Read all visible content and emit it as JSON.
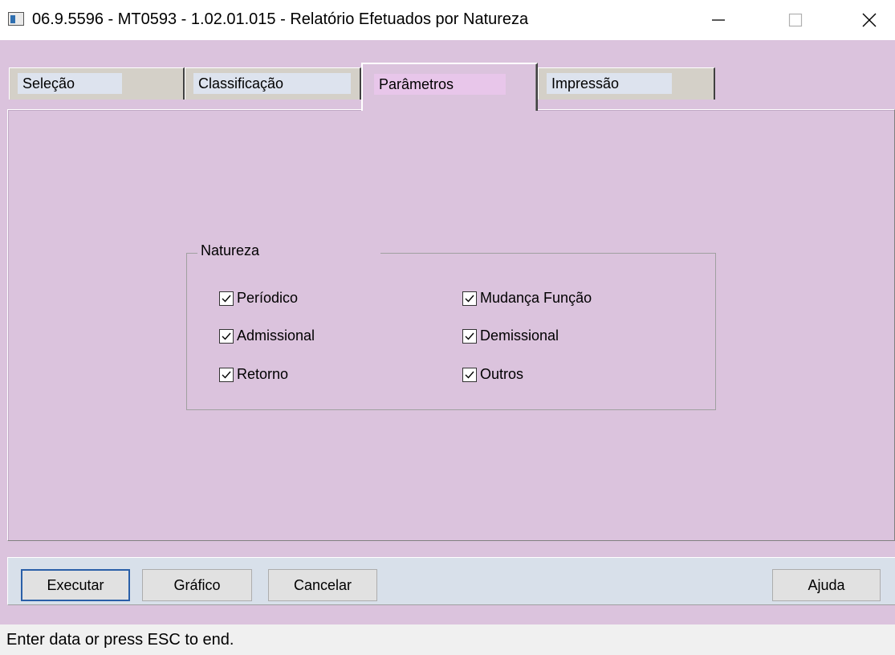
{
  "window": {
    "title": "06.9.5596 - MT0593 - 1.02.01.015 - Relatório Efetuados por Natureza"
  },
  "tabs": [
    {
      "label": "Seleção",
      "active": false
    },
    {
      "label": "Classificação",
      "active": false
    },
    {
      "label": "Parâmetros",
      "active": true
    },
    {
      "label": "Impressão",
      "active": false
    }
  ],
  "natureza": {
    "title": "Natureza",
    "options": [
      {
        "label": "Períodico",
        "checked": true
      },
      {
        "label": "Admissional",
        "checked": true
      },
      {
        "label": "Retorno",
        "checked": true
      },
      {
        "label": "Mudança Função",
        "checked": true
      },
      {
        "label": "Demissional",
        "checked": true
      },
      {
        "label": "Outros",
        "checked": true
      }
    ]
  },
  "buttons": {
    "executar": "Executar",
    "grafico": "Gráfico",
    "cancelar": "Cancelar",
    "ajuda": "Ajuda"
  },
  "status": {
    "text": "Enter data or press ESC to end."
  },
  "colors": {
    "client_bg": "#dbc3dd",
    "button_bar_bg": "#d8e0ea",
    "default_button_border": "#2a5fa8"
  },
  "icons": {
    "app": "app-window-icon",
    "minimize": "minimize-icon",
    "maximize": "maximize-icon",
    "close": "close-icon",
    "check": "checkmark-icon"
  }
}
